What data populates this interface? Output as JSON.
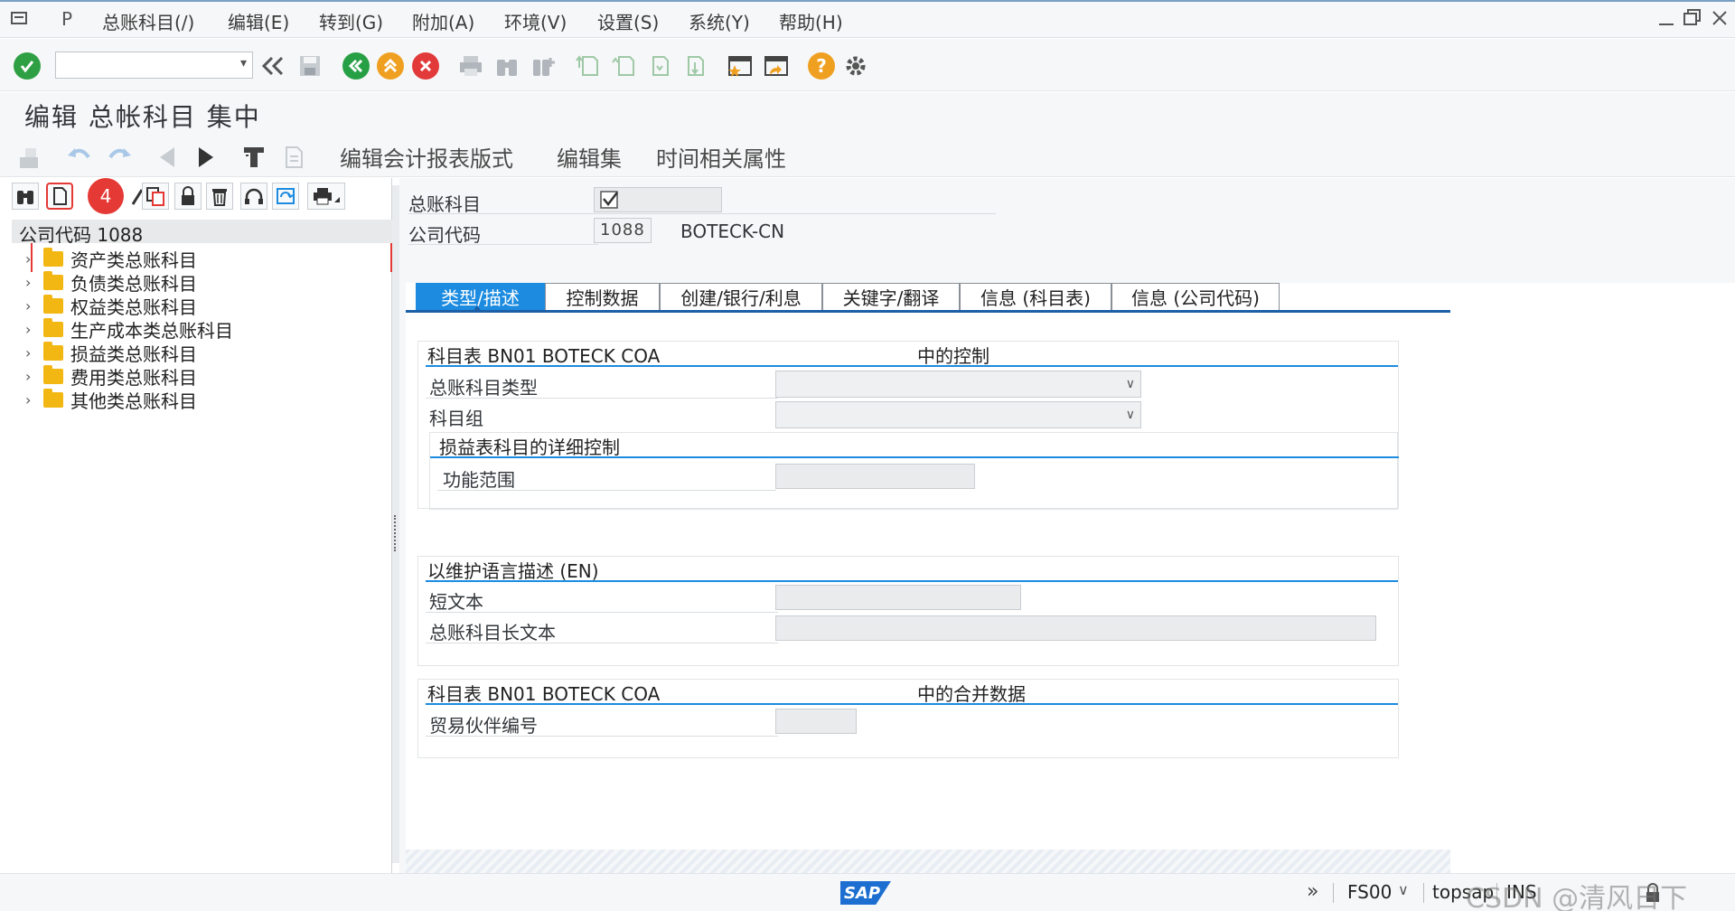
{
  "menu": {
    "items": [
      "总账科目(/)",
      "编辑(E)",
      "转到(G)",
      "附加(A)",
      "环境(V)",
      "设置(S)",
      "系统(Y)",
      "帮助(H)"
    ]
  },
  "window_controls": [
    "minimize-icon",
    "restore-icon",
    "close-icon"
  ],
  "toolbar": {
    "command_field_value": "",
    "icons": [
      "enter-icon",
      "history-icon",
      "save-icon",
      "back-icon",
      "exit-icon",
      "cancel-icon",
      "print-icon",
      "find-icon",
      "find-next-icon",
      "first-page-icon",
      "prev-page-icon",
      "next-page-icon",
      "last-page-icon",
      "new-session-icon",
      "shortcut-icon",
      "help-icon",
      "customize-icon"
    ]
  },
  "title": "编辑 总帐科目 集中",
  "app_toolbar": {
    "links": [
      "编辑会计报表版式",
      "编辑集",
      "时间相关属性"
    ]
  },
  "tree": {
    "annotation_badge": "4",
    "root": "公司代码 1088",
    "nodes": [
      "资产类总账科目",
      "负债类总账科目",
      "权益类总账科目",
      "生产成本类总账科目",
      "损益类总账科目",
      "费用类总账科目",
      "其他类总账科目"
    ]
  },
  "header": {
    "gl_account_label": "总账科目",
    "gl_account_value": "",
    "company_code_label": "公司代码",
    "company_code_value": "1088",
    "company_name": "BOTECK-CN"
  },
  "tabs": [
    "类型/描述",
    "控制数据",
    "创建/银行/利息",
    "关键字/翻译",
    "信息 (科目表)",
    "信息 (公司代码)"
  ],
  "active_tab": "类型/描述",
  "control_group": {
    "title_left": "科目表 BN01 BOTECK COA",
    "title_right": "中的控制",
    "account_type_label": "总账科目类型",
    "account_type_value": "",
    "account_group_label": "科目组",
    "account_group_value": "",
    "pl_detail_title": "损益表科目的详细控制",
    "functional_area_label": "功能范围",
    "functional_area_value": ""
  },
  "desc_group": {
    "title": "以维护语言描述 (EN)",
    "short_text_label": "短文本",
    "short_text_value": "",
    "long_text_label": "总账科目长文本",
    "long_text_value": ""
  },
  "consolidation_group": {
    "title_left": "科目表 BN01 BOTECK COA",
    "title_right": "中的合并数据",
    "trading_partner_label": "贸易伙伴编号",
    "trading_partner_value": ""
  },
  "status": {
    "logo": "SAP",
    "transaction": "FS00",
    "server": "topsap",
    "mode": "INS",
    "watermark": "CSDN @清风日下"
  },
  "colors": {
    "accent": "#1c8be0",
    "badge": "#e53935",
    "folder": "#f2b713",
    "enter_green": "#2ea043",
    "back_green": "#27a045",
    "exit_orange": "#f0a020",
    "cancel_red": "#e23a3a"
  }
}
